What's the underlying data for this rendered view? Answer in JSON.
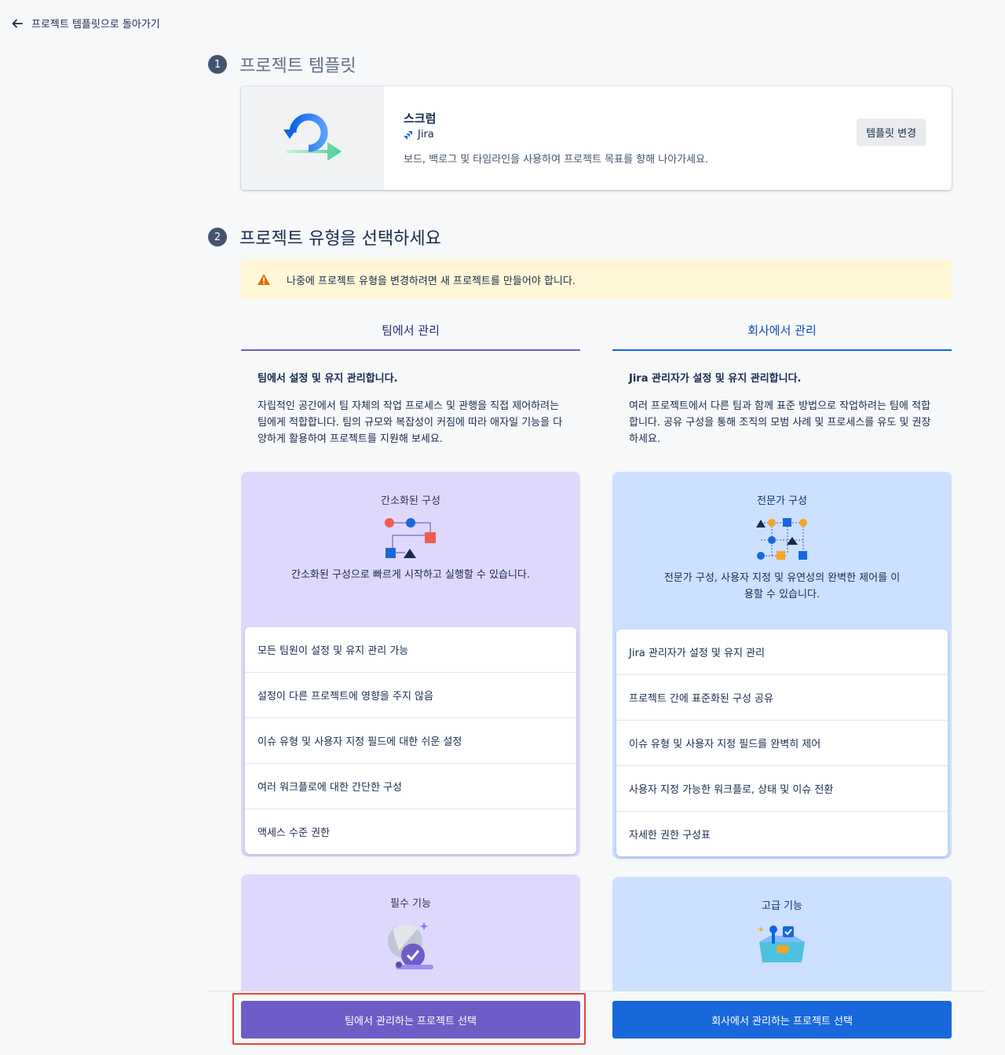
{
  "nav": {
    "back_label": "프로젝트 템플릿으로 돌아가기"
  },
  "step1": {
    "number": "1",
    "title": "프로젝트 템플릿"
  },
  "template": {
    "name": "스크럼",
    "product": "Jira",
    "description": "보드, 백로그 및 타임라인을 사용하여 프로젝트 목표를 향해 나아가세요.",
    "change_label": "템플릿 변경"
  },
  "step2": {
    "number": "2",
    "title": "프로젝트 유형을 선택하세요"
  },
  "warning": {
    "text": "나중에 프로젝트 유형을 변경하려면 새 프로젝트를 만들어야 합니다."
  },
  "team": {
    "tab_label": "팀에서 관리",
    "lead": "팀에서 설정 및 유지 관리합니다.",
    "description": "자립적인 공간에서 팀 자체의 작업 프로세스 및 관행을 직접 제어하려는 팀에게 적합합니다. 팀의 규모와 복잡성이 커짐에 따라 애자일 기능을 다양하게 활용하여 프로젝트를 지원해 보세요.",
    "box1": {
      "title": "간소화된 구성",
      "text": "간소화된 구성으로 빠르게 시작하고 실행할 수 있습니다.",
      "items": [
        "모든 팀원이 설정 및 유지 관리 가능",
        "설정이 다른 프로젝트에 영향을 주지 않음",
        "이슈 유형 및 사용자 지정 필드에 대한 쉬운 설정",
        "여러 워크플로에 대한 간단한 구성",
        "액세스 수준 권한"
      ]
    },
    "box2": {
      "title": "필수 기능"
    },
    "select_label": "팀에서 관리하는 프로젝트 선택"
  },
  "company": {
    "tab_label": "회사에서 관리",
    "lead": "Jira 관리자가 설정 및 유지 관리합니다.",
    "description": "여러 프로젝트에서 다른 팀과 함께 표준 방법으로 작업하려는 팀에 적합합니다. 공유 구성을 통해 조직의 모범 사례 및 프로세스를 유도 및 권장하세요.",
    "box1": {
      "title": "전문가 구성",
      "text": "전문가 구성, 사용자 지정 및 유연성의 완벽한 제어를 이용할 수 있습니다.",
      "items": [
        "Jira 관리자가 설정 및 유지 관리",
        "프로젝트 간에 표준화된 구성 공유",
        "이슈 유형 및 사용자 지정 필드를 완벽히 제어",
        "사용자 지정 가능한 워크플로, 상태 및 이슈 전환",
        "자세한 권한 구성표"
      ]
    },
    "box2": {
      "title": "고급 기능"
    },
    "select_label": "회사에서 관리하는 프로젝트 선택"
  },
  "colors": {
    "team_accent": "#6e5dc6",
    "company_accent": "#1868db",
    "warning_bg": "#fff7d6",
    "highlight": "#e2483d"
  }
}
